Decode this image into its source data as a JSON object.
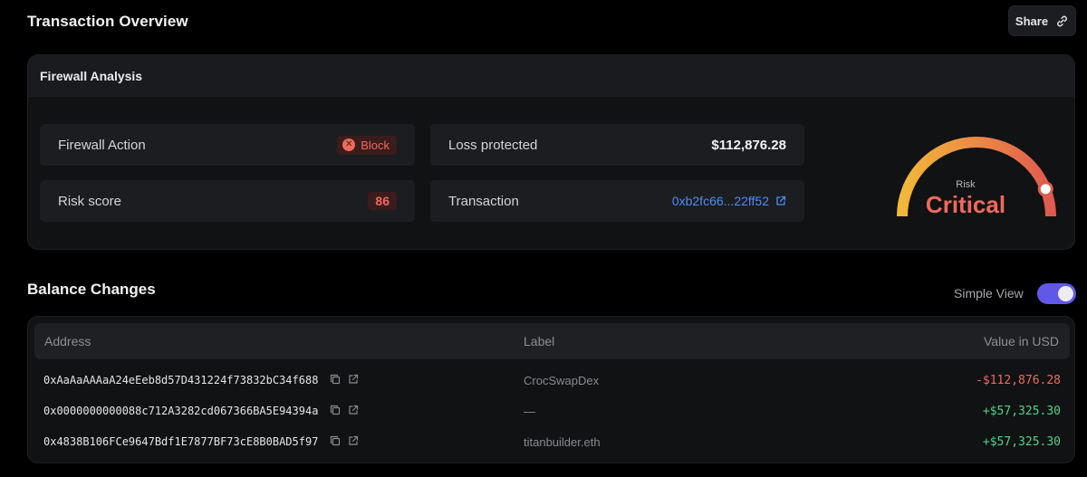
{
  "header": {
    "title": "Transaction Overview",
    "share_label": "Share"
  },
  "firewall": {
    "title": "Firewall Analysis",
    "action": {
      "label": "Firewall Action",
      "value": "Block"
    },
    "risk_score": {
      "label": "Risk score",
      "value": "86"
    },
    "loss": {
      "label": "Loss protected",
      "value": "$112,876.28"
    },
    "transaction": {
      "label": "Transaction",
      "value": "0xb2fc66...22ff52"
    },
    "gauge": {
      "caption": "Risk",
      "level": "Critical",
      "level_fraction": 0.88
    }
  },
  "balance": {
    "title": "Balance Changes",
    "simple_view_label": "Simple View",
    "simple_view_on": true,
    "columns": {
      "address": "Address",
      "label": "Label",
      "value": "Value in USD"
    },
    "rows": [
      {
        "address": "0xAaAaAAAaA24eEeb8d57D431224f73832bC34f688",
        "label": "CrocSwapDex",
        "value": "-$112,876.28",
        "sign": "negative"
      },
      {
        "address": "0x0000000000088c712A3282cd067366BA5E94394a",
        "label": "—",
        "value": "+$57,325.30",
        "sign": "positive"
      },
      {
        "address": "0x4838B106FCe9647Bdf1E7877BF73cE8B0BAD5f97",
        "label": "titanbuilder.eth",
        "value": "+$57,325.30",
        "sign": "positive"
      }
    ]
  },
  "colors": {
    "critical": "#ef6a5a",
    "positive": "#4fd38a",
    "link": "#4c8df6",
    "toggle": "#6258e8"
  }
}
